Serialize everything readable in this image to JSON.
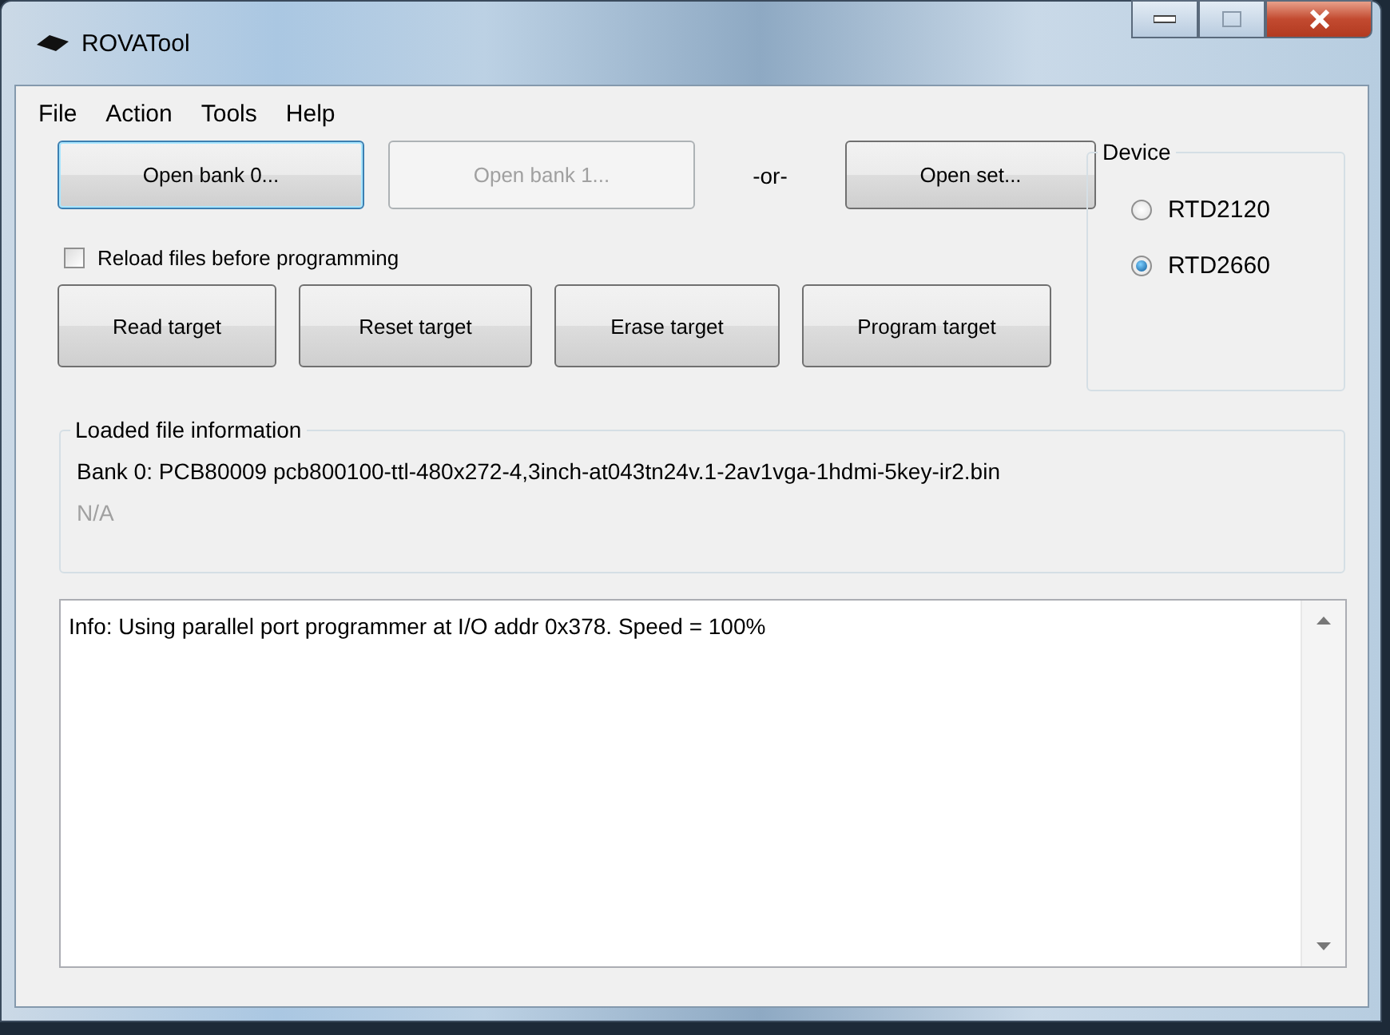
{
  "window": {
    "title": "ROVATool"
  },
  "menu": [
    "File",
    "Action",
    "Tools",
    "Help"
  ],
  "open_row": [
    {
      "kind": "button",
      "label": "Open bank 0...",
      "disabled": false,
      "focused": true
    },
    {
      "kind": "button",
      "label": "Open bank 1...",
      "disabled": true,
      "focused": false
    },
    {
      "kind": "text",
      "label": "-or-"
    },
    {
      "kind": "button",
      "label": "Open set...",
      "disabled": false,
      "focused": false
    }
  ],
  "reload_checkbox": {
    "label": "Reload files before programming",
    "checked": false
  },
  "action_buttons": [
    "Read target",
    "Reset target",
    "Erase target",
    "Program target"
  ],
  "device": {
    "title": "Device",
    "options": [
      {
        "label": "RTD2120",
        "selected": false
      },
      {
        "label": "RTD2660",
        "selected": true
      }
    ]
  },
  "loaded_info": {
    "title": "Loaded file information",
    "lines": [
      {
        "text": "Bank 0: PCB80009 pcb800100-ttl-480x272-4,3inch-at043tn24v.1-2av1vga-1hdmi-5key-ir2.bin",
        "disabled": false
      },
      {
        "text": "N/A",
        "disabled": true
      }
    ]
  },
  "log": [
    "Info: Using parallel port programmer at I/O addr 0x378. Speed = 100%"
  ]
}
